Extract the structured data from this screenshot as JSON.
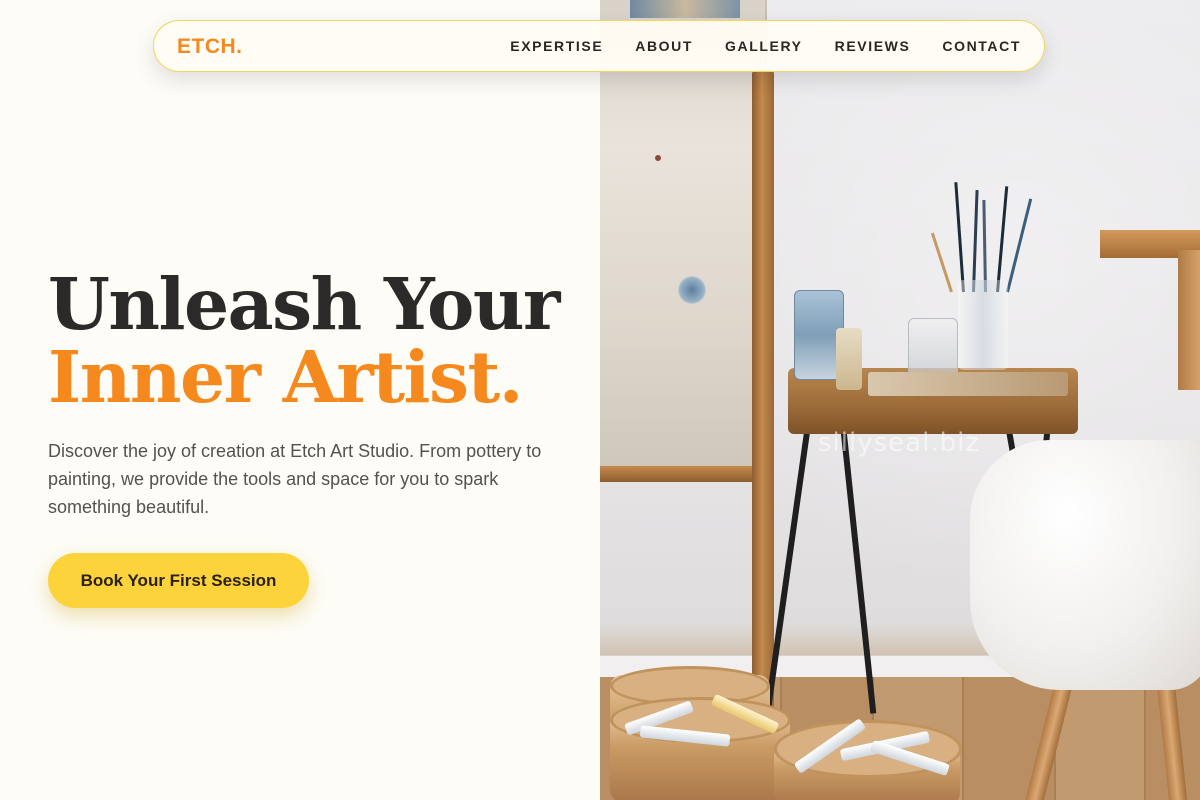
{
  "nav": {
    "logo": "ETCH.",
    "links": [
      {
        "label": "EXPERTISE"
      },
      {
        "label": "ABOUT"
      },
      {
        "label": "GALLERY"
      },
      {
        "label": "REVIEWS"
      },
      {
        "label": "CONTACT"
      }
    ]
  },
  "hero": {
    "heading_line1": "Unleash Your",
    "heading_line2": "Inner Artist.",
    "description": "Discover the joy of creation at Etch Art Studio. From pottery to painting, we provide the tools and space for you to spark something beautiful.",
    "cta_label": "Book Your First Session"
  },
  "photo": {
    "watermark": "sillyseal.biz"
  },
  "colors": {
    "accent": "#f5891e",
    "cta_background": "#fcd33a",
    "page_background": "#fdfcf6",
    "heading": "#2c2a28"
  }
}
